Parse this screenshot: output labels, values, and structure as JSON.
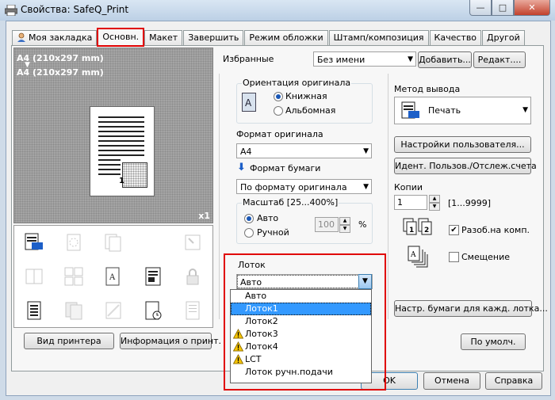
{
  "window": {
    "title": "Свойства: SafeQ_Print",
    "minimize": "—",
    "maximize": "□",
    "close": "✕"
  },
  "tabs": [
    {
      "label": "Моя закладка"
    },
    {
      "label": "Основн."
    },
    {
      "label": "Макет"
    },
    {
      "label": "Завершить"
    },
    {
      "label": "Режим обложки"
    },
    {
      "label": "Штамп/композиция"
    },
    {
      "label": "Качество"
    },
    {
      "label": "Другой"
    }
  ],
  "preview": {
    "line1": "A4 (210x297 mm)",
    "line2": "A4 (210x297 mm)",
    "page_number": "1",
    "copies": "x1"
  },
  "left_buttons": {
    "printer_view": "Вид принтера",
    "printer_info": "Информация о принт."
  },
  "favorites": {
    "label": "Избранные",
    "value": "Без имени",
    "add": "Добавить...",
    "edit": "Редакт...."
  },
  "orientation": {
    "label": "Ориентация оригинала",
    "portrait": "Книжная",
    "landscape": "Альбомная",
    "selected": "portrait"
  },
  "original_size": {
    "label": "Формат оригинала",
    "value": "A4"
  },
  "paper_size": {
    "label": "Формат бумаги",
    "value": "По формату оригинала"
  },
  "scale": {
    "label": "Масштаб [25...400%]",
    "auto": "Авто",
    "manual": "Ручной",
    "value": "100",
    "unit": "%"
  },
  "tray": {
    "label": "Лоток",
    "value": "Авто",
    "options": [
      {
        "label": "Авто",
        "warning": false
      },
      {
        "label": "Лоток1",
        "warning": false,
        "selected": true
      },
      {
        "label": "Лоток2",
        "warning": false
      },
      {
        "label": "Лоток3",
        "warning": true
      },
      {
        "label": "Лоток4",
        "warning": true
      },
      {
        "label": "LCT",
        "warning": true
      },
      {
        "label": "Лоток ручн.подачи",
        "warning": false
      }
    ]
  },
  "output_method": {
    "label": "Метод вывода",
    "value": "Печать"
  },
  "right_buttons": {
    "user_settings": "Настройки пользователя...",
    "user_auth": "Идент. Пользов./Отслеж.счета",
    "paper_per_tray": "Настр. бумаги для кажд. лотка...",
    "defaults": "По умолч."
  },
  "copies": {
    "label": "Копии",
    "value": "1",
    "range": "[1...9999]",
    "collate": "Разоб.на комп.",
    "offset": "Смещение"
  },
  "footer": {
    "ok": "OK",
    "cancel": "Отмена",
    "help": "Справка"
  }
}
